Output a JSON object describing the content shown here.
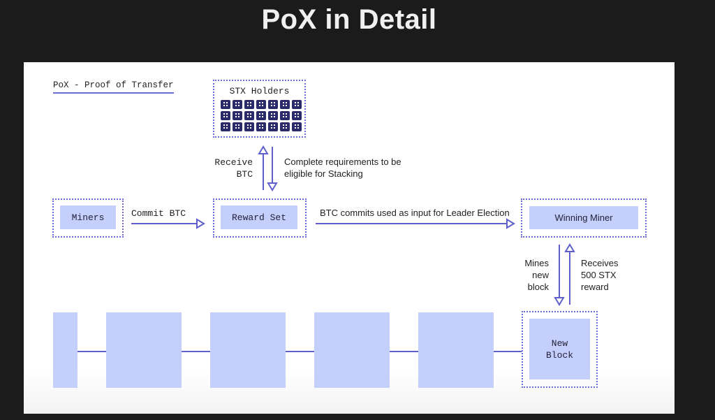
{
  "slide": {
    "title": "PoX in Detail"
  },
  "diagram": {
    "subtitle": "PoX - Proof of Transfer",
    "stx_holders": {
      "label": "STX Holders",
      "icon_rows": 3,
      "icon_cols": 7,
      "icon": "wallet-icon"
    },
    "miners": {
      "label": "Miners"
    },
    "reward_set": {
      "label": "Reward Set"
    },
    "winning_miner": {
      "label": "Winning Miner"
    },
    "new_block": {
      "label_line1": "New",
      "label_line2": "Block"
    },
    "arrows": {
      "commit_btc": "Commit BTC",
      "receive_btc_line1": "Receive",
      "receive_btc_line2": "BTC",
      "requirements_line1": "Complete requirements to be",
      "requirements_line2": "eligible for Stacking",
      "leader_election": "BTC commits used as input for Leader Election",
      "mines_line1": "Mines",
      "mines_line2": "new",
      "mines_line3": "block",
      "receives_line1": "Receives",
      "receives_line2": "500 STX",
      "receives_line3": "reward"
    },
    "chain_blocks_count": 6,
    "colors": {
      "accent": "#6b6bd6",
      "block_fill": "#c5cffb",
      "icon_fill": "#2a2a6a"
    }
  }
}
